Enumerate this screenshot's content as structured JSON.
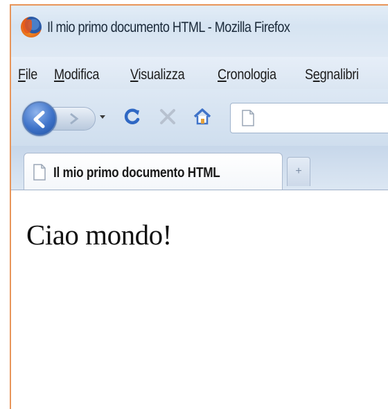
{
  "window": {
    "title": "Il mio primo documento HTML - Mozilla Firefox",
    "app_icon": "firefox-logo"
  },
  "menubar": {
    "items": [
      {
        "mnemonic": "F",
        "rest": "ile"
      },
      {
        "mnemonic": "M",
        "rest": "odifica"
      },
      {
        "mnemonic": "V",
        "rest": "isualizza"
      },
      {
        "mnemonic": "C",
        "rest": "ronologia"
      },
      {
        "prefix": "S",
        "mnemonic": "e",
        "rest": "gnalibri"
      }
    ]
  },
  "navbar": {
    "icons": [
      "back-arrow-icon",
      "forward-arrow-icon",
      "dropdown-arrow-icon",
      "reload-icon",
      "stop-icon",
      "home-icon",
      "page-icon"
    ],
    "url": ""
  },
  "tabs": {
    "active_label": "Il mio primo documento HTML",
    "new_tab_symbol": "+"
  },
  "content": {
    "text": "Ciao mondo!"
  },
  "colors": {
    "frame_border": "#e8955a",
    "chrome_bg": "#d6e4f2",
    "back_button": "#3f73c9",
    "reload": "#2f68c4",
    "home": "#3f73c9"
  }
}
